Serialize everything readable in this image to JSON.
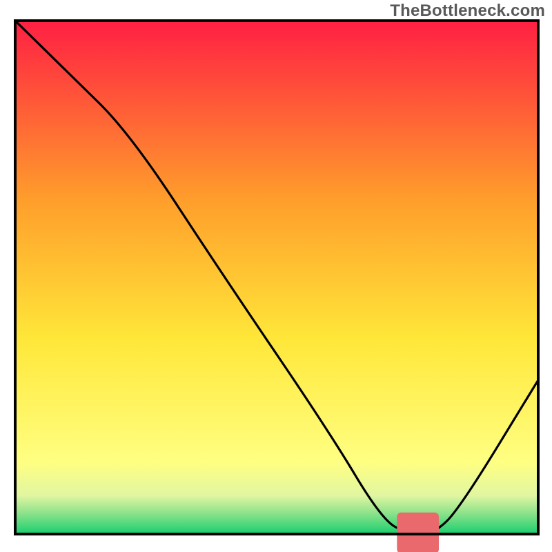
{
  "watermark": "TheBottleneck.com",
  "chart_data": {
    "type": "line",
    "title": "",
    "xlabel": "",
    "ylabel": "",
    "xlim": [
      0,
      100
    ],
    "ylim": [
      0,
      100
    ],
    "grid": false,
    "legend": false,
    "series": [
      {
        "name": "bottleneck-curve",
        "color": "#000000",
        "x": [
          0,
          10,
          22,
          40,
          60,
          70,
          75,
          80,
          85,
          100
        ],
        "y": [
          100,
          90,
          78,
          50,
          20,
          3,
          0,
          0,
          5,
          30
        ]
      }
    ],
    "marker": {
      "name": "optimal-zone",
      "color": "#e9696c",
      "x_center": 77,
      "y": 0.2,
      "width": 8,
      "thickness": 4
    },
    "background_gradient": {
      "top": "#ff1f43",
      "mid_upper": "#ff9e2b",
      "mid": "#ffe739",
      "mid_lower": "#ffff82",
      "green_band_top": "#e1f6a1",
      "green_band_mid": "#8be28a",
      "bottom": "#18cf6f"
    },
    "frame_color": "#000000"
  }
}
